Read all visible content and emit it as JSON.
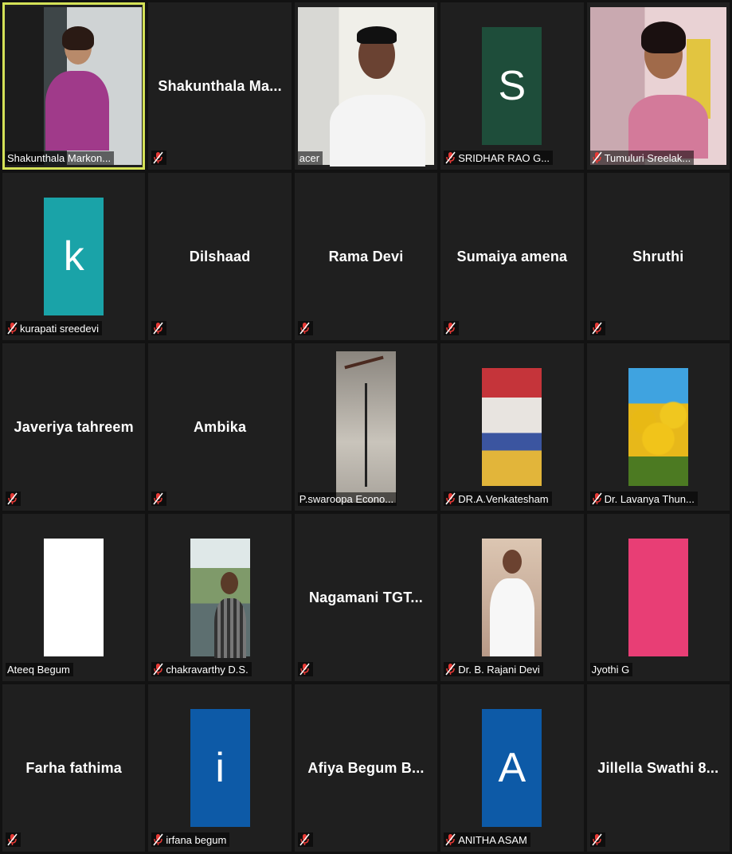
{
  "tiles": [
    {
      "name": "Shakunthala Markon...",
      "center_name": "",
      "kind": "video-woman",
      "muted": false,
      "active": true
    },
    {
      "name": "",
      "center_name": "Shakunthala  Ma...",
      "kind": "name",
      "muted": true
    },
    {
      "name": "acer",
      "center_name": "",
      "kind": "video-man",
      "muted": false
    },
    {
      "name": "SRIDHAR RAO G...",
      "center_name": "",
      "kind": "avatar",
      "avatar_letter": "S",
      "avatar_color": "#1e4d3a",
      "muted": true
    },
    {
      "name": "Tumuluri Sreelak...",
      "center_name": "",
      "kind": "video-woman2",
      "muted": true
    },
    {
      "name": "kurapati sreedevi",
      "center_name": "",
      "kind": "avatar",
      "avatar_letter": "k",
      "avatar_color": "#1aa3a8",
      "muted": true
    },
    {
      "name": "",
      "center_name": "Dilshaad",
      "kind": "name",
      "muted": true
    },
    {
      "name": "",
      "center_name": "Rama Devi",
      "kind": "name",
      "muted": true
    },
    {
      "name": "",
      "center_name": "Sumaiya amena",
      "kind": "name",
      "muted": true
    },
    {
      "name": "",
      "center_name": "Shruthi",
      "kind": "name",
      "muted": true
    },
    {
      "name": "",
      "center_name": "Javeriya tahreem",
      "kind": "name",
      "muted": true
    },
    {
      "name": "",
      "center_name": "Ambika",
      "kind": "name",
      "muted": true
    },
    {
      "name": "P.swaroopa Econo...",
      "center_name": "",
      "kind": "photo-fan",
      "muted": false
    },
    {
      "name": "DR.A.Venkatesham",
      "center_name": "",
      "kind": "photo-event",
      "muted": true
    },
    {
      "name": "Dr. Lavanya Thun...",
      "center_name": "",
      "kind": "photo-tulips",
      "muted": true
    },
    {
      "name": "Ateeq Begum",
      "center_name": "",
      "kind": "photo-white",
      "muted": false
    },
    {
      "name": "chakravarthy D.S.",
      "center_name": "",
      "kind": "photo-man-outdoor",
      "muted": true
    },
    {
      "name": "",
      "center_name": "Nagamani  TGT...",
      "kind": "name",
      "muted": true
    },
    {
      "name": "Dr. B. Rajani Devi",
      "center_name": "",
      "kind": "photo-man-white",
      "muted": true
    },
    {
      "name": "Jyothi G",
      "center_name": "",
      "kind": "photo-pink",
      "muted": false
    },
    {
      "name": "",
      "center_name": "Farha fathima",
      "kind": "name",
      "muted": true
    },
    {
      "name": "irfana begum",
      "center_name": "",
      "kind": "avatar",
      "avatar_letter": "i",
      "avatar_color": "#0d5aa7",
      "muted": true
    },
    {
      "name": "",
      "center_name": "Afiya Begum  B...",
      "kind": "name",
      "muted": true
    },
    {
      "name": "ANITHA ASAM",
      "center_name": "",
      "kind": "avatar",
      "avatar_letter": "A",
      "avatar_color": "#0d5aa7",
      "muted": true
    },
    {
      "name": "",
      "center_name": "Jillella  Swathi  8...",
      "kind": "name",
      "muted": true
    }
  ],
  "colors": {
    "active_outline": "#d4e157",
    "mute_icon": "#e53935",
    "tile_bg": "#1f1f1f"
  }
}
